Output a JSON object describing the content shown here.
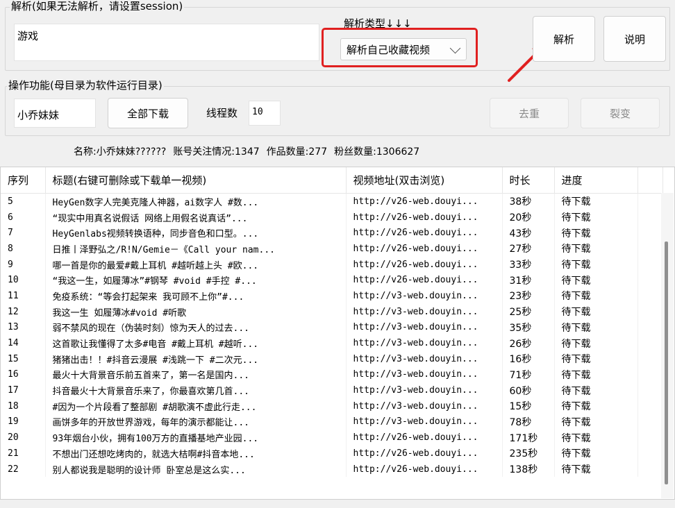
{
  "parse_group": {
    "title": "解析(如果无法解析，请设置session)",
    "input_value": "游戏",
    "type_label": "解析类型↓↓↓",
    "type_selected": "解析自己收藏视频",
    "parse_button": "解析",
    "help_button": "说明"
  },
  "ops_group": {
    "title": "操作功能(母目录为软件运行目录)",
    "user_value": "小乔妹妹",
    "download_all_button": "全部下载",
    "threads_label": "线程数",
    "threads_value": "10",
    "dedupe_button": "去重",
    "fission_button": "裂变"
  },
  "account_info": {
    "name": "名称:小乔妹妹??????",
    "follow": "账号关注情况:1347",
    "works": "作品数量:277",
    "fans": "粉丝数量:1306627"
  },
  "colors": {
    "highlight": "#e02020"
  },
  "table": {
    "columns": [
      "序列",
      "标题(右键可删除或下载单一视频)",
      "视频地址(双击浏览)",
      "时长",
      "进度"
    ],
    "rows": [
      [
        "5",
        "HeyGen数字人完美克隆人神器，ai数字人 #数...",
        "http://v26-web.douyi...",
        "38秒",
        "待下载"
      ],
      [
        "6",
        "“现实中用真名说假话 网络上用假名说真话”...",
        "http://v26-web.douyi...",
        "20秒",
        "待下载"
      ],
      [
        "7",
        "HeyGenlabs视频转换语种，同步音色和口型。...",
        "http://v26-web.douyi...",
        "43秒",
        "待下载"
      ],
      [
        "8",
        "日推丨泽野弘之/R!N/Gemie－《Call your nam...",
        "http://v26-web.douyi...",
        "27秒",
        "待下载"
      ],
      [
        "9",
        "哪一首是你的最爱#戴上耳机 #越听越上头 #欧...",
        "http://v26-web.douyi...",
        "33秒",
        "待下载"
      ],
      [
        "10",
        "“我这一生，如履薄冰”#钢琴 #void #手控 #...",
        "http://v26-web.douyi...",
        "31秒",
        "待下载"
      ],
      [
        "11",
        "免疫系统：“等会打起架来 我可顾不上你”#...",
        "http://v3-web.douyin...",
        "23秒",
        "待下载"
      ],
      [
        "12",
        "我这一生  如履薄冰#void #听歌",
        "http://v3-web.douyin...",
        "25秒",
        "待下载"
      ],
      [
        "13",
        "弱不禁风的现在（伪装时刻）惊为天人的过去...",
        "http://v3-web.douyin...",
        "35秒",
        "待下载"
      ],
      [
        "14",
        "这首歌让我懂得了太多#电音 #戴上耳机 #越听...",
        "http://v3-web.douyin...",
        "26秒",
        "待下载"
      ],
      [
        "15",
        "猪猪出击！！#抖音云漫展 #浅跳一下 #二次元...",
        "http://v3-web.douyin...",
        "16秒",
        "待下载"
      ],
      [
        "16",
        "最火十大背景音乐前五首来了，第一名是国内...",
        "http://v3-web.douyin...",
        "71秒",
        "待下载"
      ],
      [
        "17",
        "抖音最火十大背景音乐来了，你最喜欢第几首...",
        "http://v3-web.douyin...",
        "60秒",
        "待下载"
      ],
      [
        "18",
        "#因为一个片段看了整部剧 #胡歌演不虚此行走...",
        "http://v3-web.douyin...",
        "15秒",
        "待下载"
      ],
      [
        "19",
        "画饼多年的开放世界游戏，每年的演示都能让...",
        "http://v3-web.douyin...",
        "78秒",
        "待下载"
      ],
      [
        "20",
        "93年烟台小伙，拥有100万方的直播基地产业园...",
        "http://v26-web.douyi...",
        "171秒",
        "待下载"
      ],
      [
        "21",
        "不想出门还想吃烤肉的，就选大桔啊#抖音本地...",
        "http://v26-web.douyi...",
        "235秒",
        "待下载"
      ],
      [
        "22",
        "别人都说我是聪明的设计师  卧室总是这么实...",
        "http://v26-web.douyi...",
        "138秒",
        "待下载"
      ]
    ]
  }
}
